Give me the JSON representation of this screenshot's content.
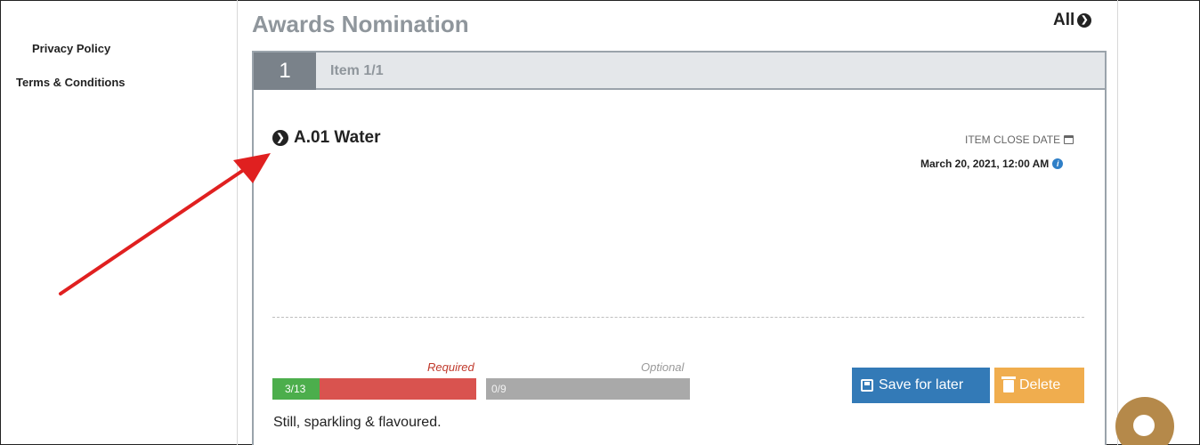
{
  "sidebar": {
    "links": [
      {
        "label": "Privacy Policy"
      },
      {
        "label": "Terms & Conditions"
      }
    ]
  },
  "header": {
    "title": "Awards Nomination",
    "all_link": "All",
    "all_icon": "chevron-right-circle-icon"
  },
  "card": {
    "step_number": "1",
    "step_label": "Item 1/1",
    "item_title": "A.01 Water",
    "item_title_icon": "chevron-down-circle-icon",
    "close_date_label": "ITEM CLOSE DATE",
    "close_date_icon": "calendar-icon",
    "close_date_value": "March 20, 2021, 12:00 AM",
    "info_icon": "info-icon",
    "progress": {
      "required_label": "Required",
      "required_text": "3/13",
      "required_done": 3,
      "required_total": 13,
      "optional_label": "Optional",
      "optional_text": "0/9",
      "optional_done": 0,
      "optional_total": 9
    },
    "buttons": {
      "save_label": "Save for later",
      "save_icon": "floppy-disk-icon",
      "delete_label": "Delete",
      "delete_icon": "trash-icon"
    },
    "description": "Still, sparkling & flavoured."
  },
  "colors": {
    "required_done": "#4cae4c",
    "required_remaining": "#d9534f",
    "optional": "#a9a9a9",
    "save_button": "#337ab7",
    "delete_button": "#f0ad4e",
    "annotation_arrow": "#e02020",
    "chat_bubble": "#b5894a"
  }
}
